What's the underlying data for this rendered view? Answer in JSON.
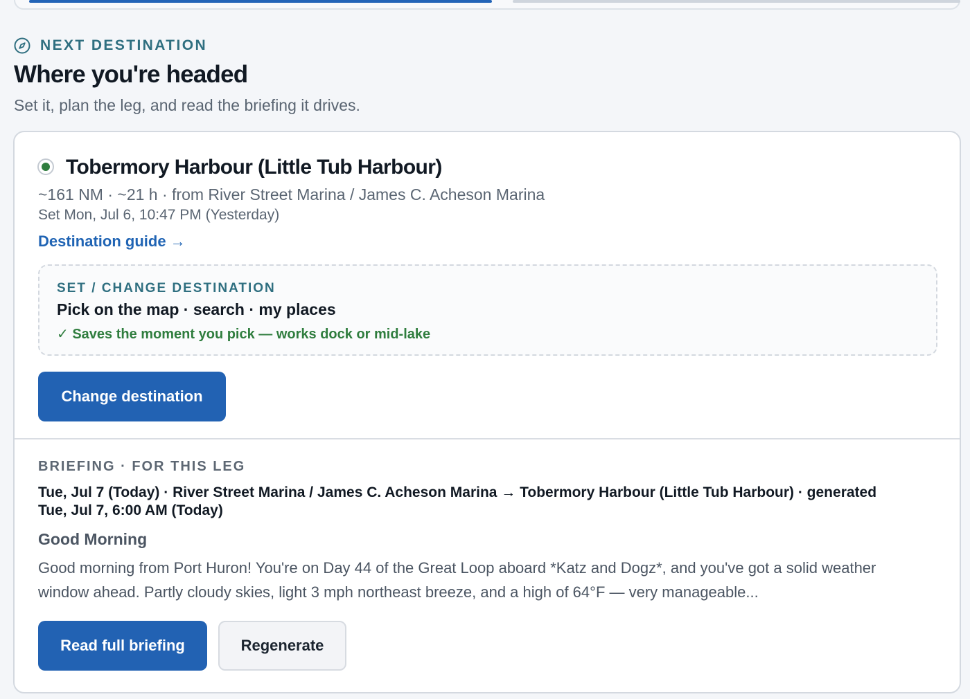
{
  "section": {
    "eyebrow": "NEXT DESTINATION",
    "title": "Where you're headed",
    "subtitle": "Set it, plan the leg, and read the briefing it drives.",
    "icon": "compass-icon"
  },
  "destination": {
    "status_color": "#2f7d3e",
    "name": "Tobermory Harbour (Little Tub Harbour)",
    "meta": "~161 NM · ~21 h · from River Street Marina / James C. Acheson Marina",
    "set_time": "Set Mon, Jul 6, 10:47 PM (Yesterday)",
    "guide_link": "Destination guide →"
  },
  "change_panel": {
    "eyebrow": "SET / CHANGE DESTINATION",
    "title": "Pick on the map · search · my places",
    "note": "✓ Saves the moment you pick — works dock or mid-lake",
    "button": "Change destination"
  },
  "briefing": {
    "eyebrow": "BRIEFING · FOR THIS LEG",
    "route": "Tue, Jul 7 (Today) · River Street Marina / James C. Acheson Marina → Tobermory Harbour (Little Tub Harbour) · generated Tue, Jul 7, 6:00 AM (Today)",
    "heading": "Good Morning",
    "body": "Good morning from Port Huron! You're on Day 44 of the Great Loop aboard *Katz and Dogz*, and you've got a solid weather window ahead. Partly cloudy skies, light 3 mph northeast breeze, and a high of 64°F — very manageable...",
    "read_button": "Read full briefing",
    "regen_button": "Regenerate"
  },
  "colors": {
    "accent": "#2262b3",
    "eyebrow_teal": "#2f6f80",
    "success_green": "#2f7d3e"
  }
}
